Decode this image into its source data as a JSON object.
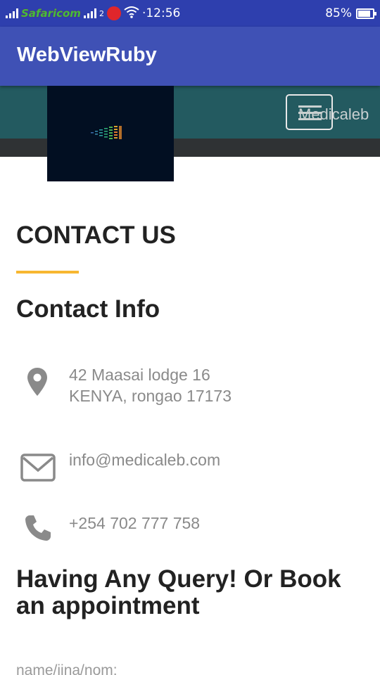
{
  "status_bar": {
    "carrier": "Safaricom",
    "sim_slot": "2",
    "time": "·12:56",
    "battery": "85%",
    "battery_level": 0.85
  },
  "app_bar": {
    "title": "WebViewRuby"
  },
  "site_header": {
    "brand": "Medicaleb",
    "menu_icon": "hamburger-icon",
    "colors": {
      "header": "#235a60",
      "subbar": "#2f3234",
      "logo_bg": "#020f22"
    }
  },
  "page": {
    "heading": "CONTACT US",
    "accent_color": "#f7b731",
    "contact_info_heading": "Contact Info",
    "address_line1": "42 Maasai lodge 16",
    "address_line2": "KENYA, rongao 17173",
    "email": "info@medicaleb.com",
    "phone": "+254 702 777 758",
    "query_heading": "Having Any Query! Or Book an appointment",
    "name_label": "name/jina/nom:"
  },
  "icons": {
    "address": "map-pin-icon",
    "email": "envelope-icon",
    "phone": "phone-icon"
  }
}
